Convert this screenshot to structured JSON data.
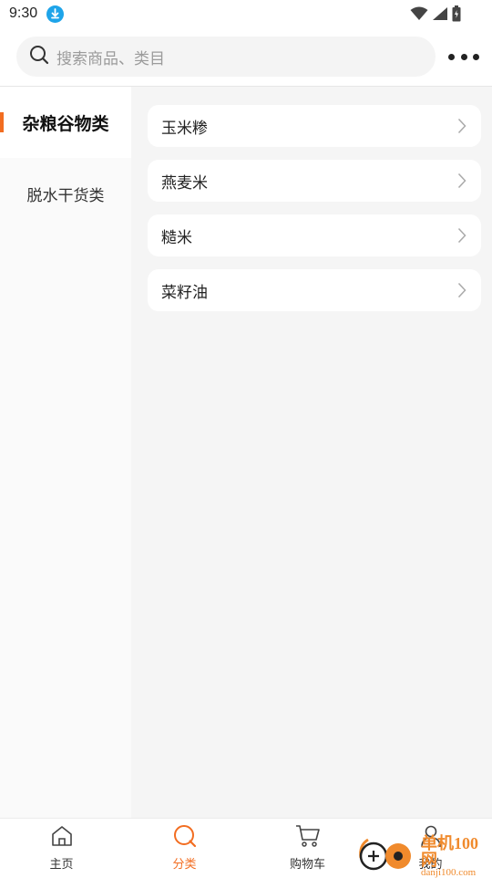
{
  "status_bar": {
    "time": "9:30"
  },
  "search": {
    "placeholder": "搜索商品、类目"
  },
  "sidebar": {
    "items": [
      {
        "label": "杂粮谷物类",
        "active": true
      },
      {
        "label": "脱水干货类",
        "active": false
      }
    ]
  },
  "subcategories": [
    {
      "label": "玉米糁"
    },
    {
      "label": "燕麦米"
    },
    {
      "label": "糙米"
    },
    {
      "label": "菜籽油"
    }
  ],
  "tabbar": {
    "tabs": [
      {
        "label": "主页",
        "icon": "home-icon"
      },
      {
        "label": "分类",
        "icon": "search-circle-icon",
        "active": true
      },
      {
        "label": "购物车",
        "icon": "cart-icon"
      },
      {
        "label": "我的",
        "icon": "user-icon"
      }
    ]
  },
  "watermark": {
    "title": "单机100网",
    "url": "danji100.com"
  },
  "colors": {
    "accent": "#f26d21",
    "sidebar_bg": "#fafafa",
    "content_bg": "#f5f5f5",
    "download_icon": "#1ea4e9"
  }
}
